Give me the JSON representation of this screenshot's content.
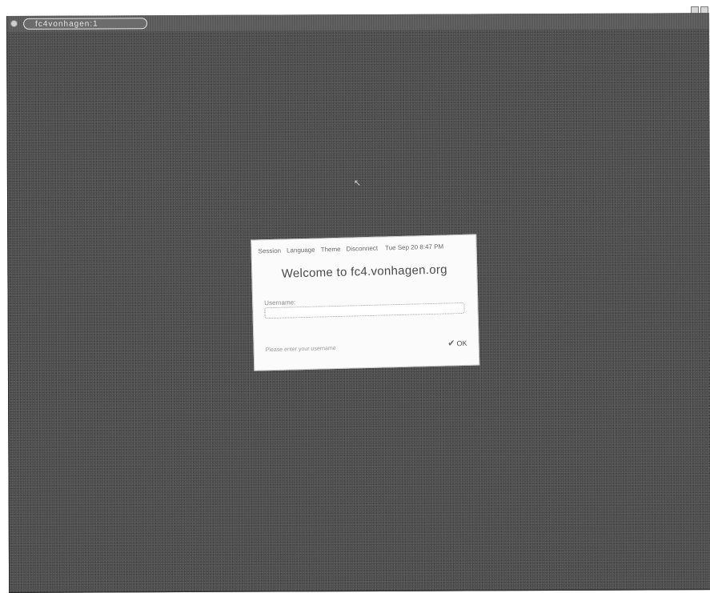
{
  "window": {
    "title": "fc4vonhagen:1"
  },
  "dialog": {
    "menu": {
      "session": "Session",
      "language": "Language",
      "theme": "Theme",
      "disconnect": "Disconnect",
      "clock": "Tue Sep 20  8:47 PM"
    },
    "welcome": "Welcome to fc4.vonhagen.org",
    "prompt_label": "Username:",
    "username_value": "",
    "message": "Please enter your username",
    "ok_label": "OK"
  },
  "icons": {
    "ok": "ok-check-icon",
    "cursor": "mouse-cursor-icon",
    "window_menu": "window-menu-icon"
  },
  "colors": {
    "desktop": "#4e4e4e",
    "dialog": "#fbfbfb"
  }
}
